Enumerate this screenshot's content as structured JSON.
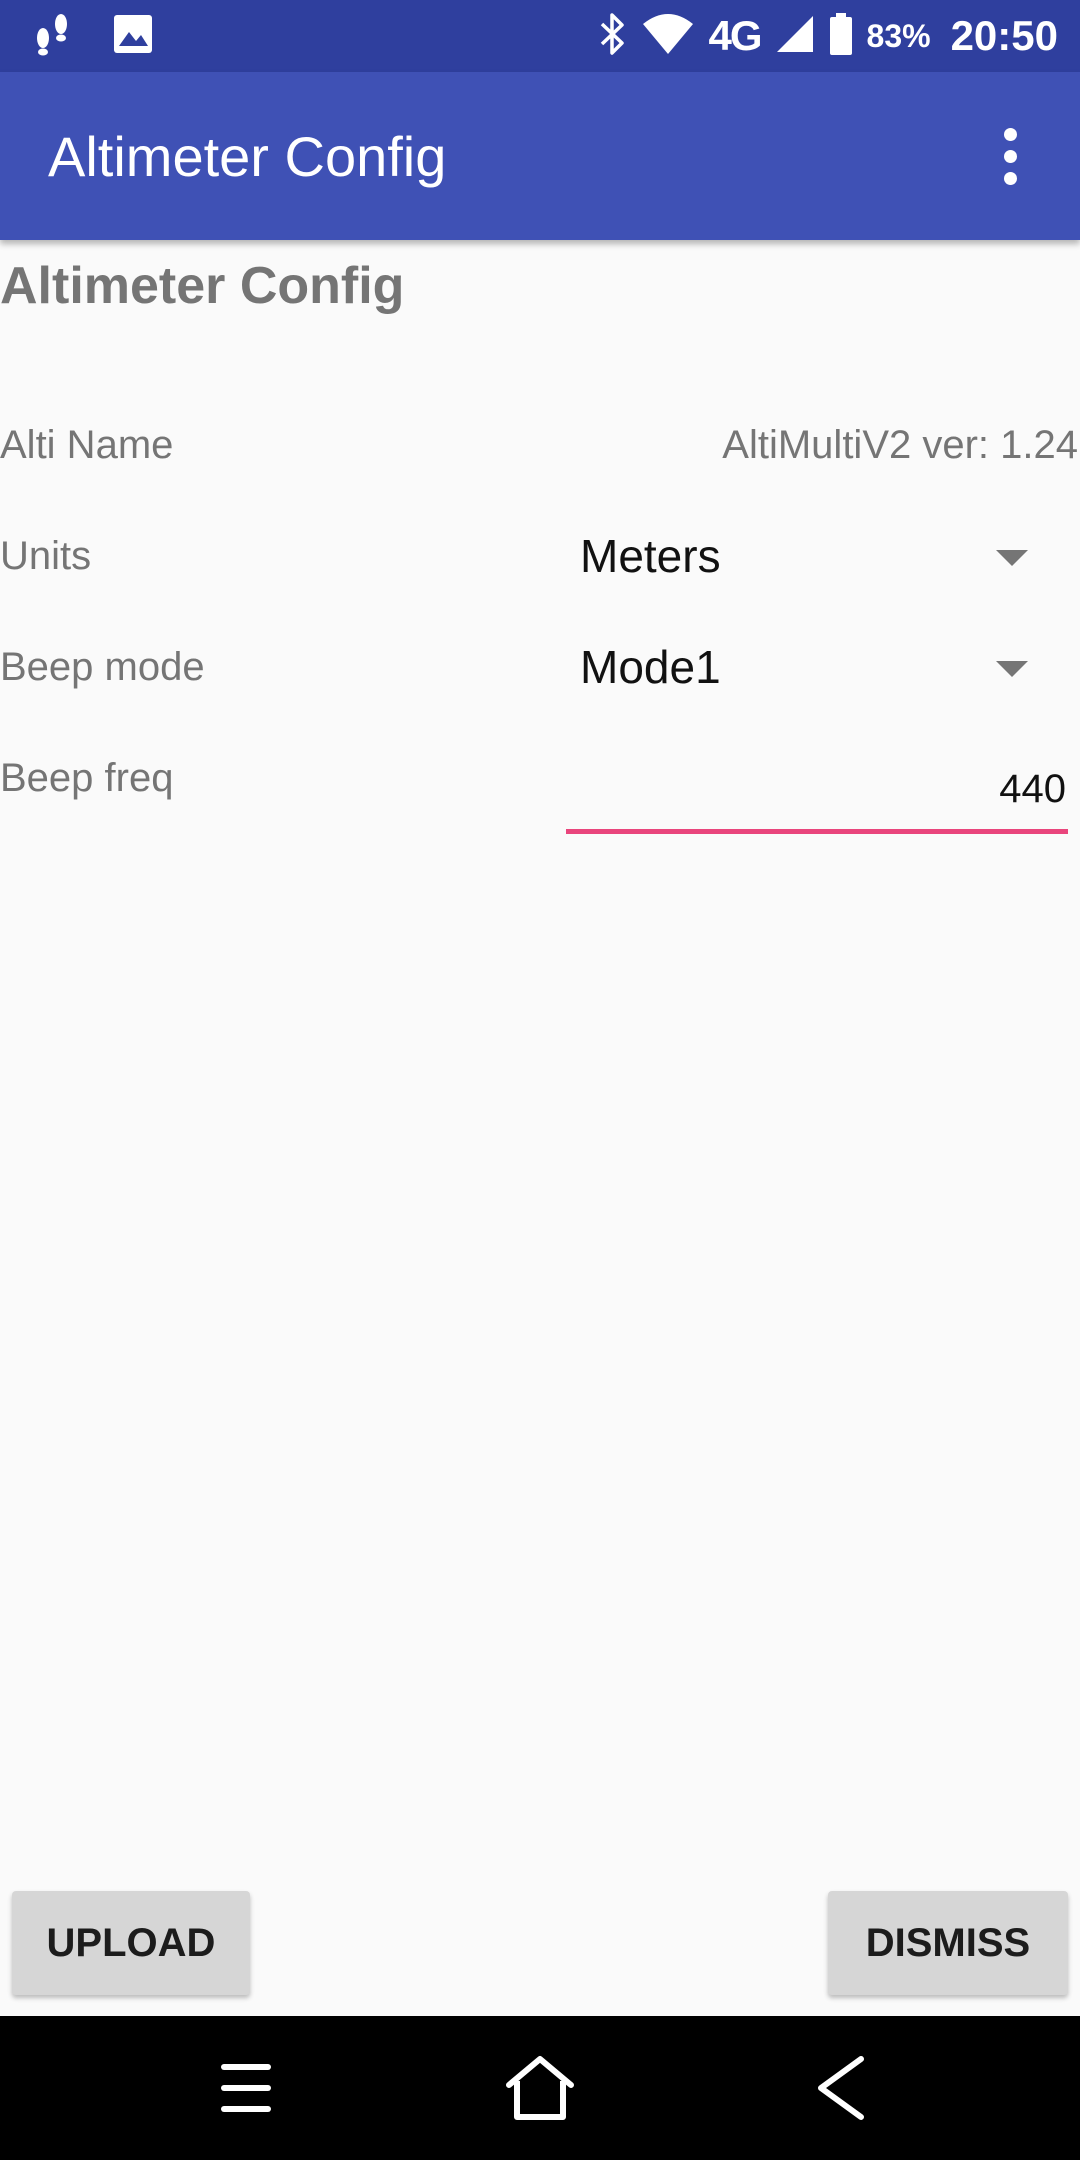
{
  "status_bar": {
    "left_icons": [
      "footprints-icon",
      "image-icon"
    ],
    "right_icons": [
      "bluetooth-icon",
      "wifi-icon",
      "signal-icon",
      "battery-icon"
    ],
    "network": "4G",
    "battery_percent": "83%",
    "time": "20:50"
  },
  "app_bar": {
    "title": "Altimeter Config",
    "overflow_icon": "more-vert-icon"
  },
  "page": {
    "title": "Altimeter Config",
    "alti_name_label": "Alti Name",
    "alti_name_value": "AltiMultiV2 ver: 1.24",
    "units_label": "Units",
    "units_value": "Meters",
    "beep_mode_label": "Beep mode",
    "beep_mode_value": "Mode1",
    "beep_freq_label": "Beep freq",
    "beep_freq_value": "440"
  },
  "buttons": {
    "upload": "UPLOAD",
    "dismiss": "DISMISS"
  },
  "nav_bar": {
    "icons": [
      "menu-icon",
      "home-icon",
      "back-icon"
    ]
  },
  "colors": {
    "status_bar": "#2f3f9e",
    "app_bar": "#3f51b5",
    "accent": "#e9457c",
    "button": "#d6d6d6",
    "label": "#757575"
  }
}
